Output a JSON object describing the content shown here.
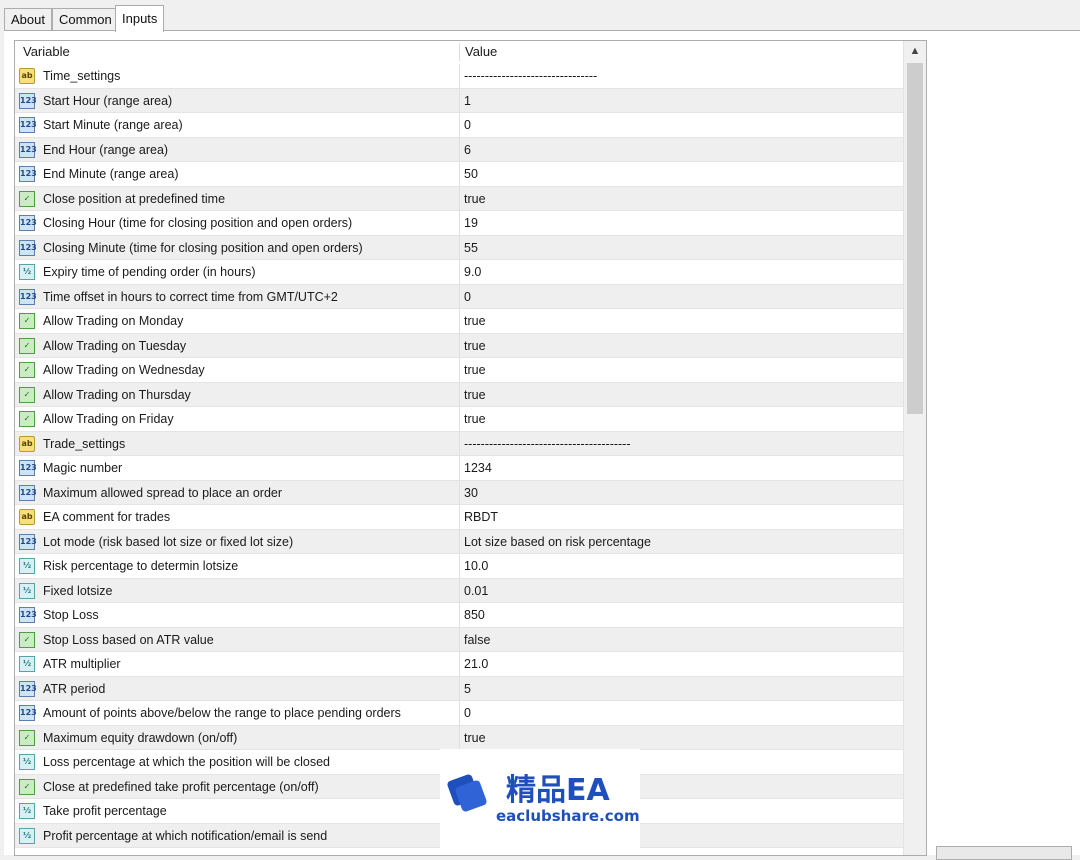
{
  "tabs": [
    {
      "label": "About"
    },
    {
      "label": "Common"
    },
    {
      "label": "Inputs"
    }
  ],
  "grid": {
    "columns": {
      "variable": "Variable",
      "value": "Value"
    },
    "rows": [
      {
        "icon": "ab",
        "name": "Time_settings",
        "value": "--------------------------------"
      },
      {
        "icon": "123",
        "name": "Start Hour (range area)",
        "value": "1"
      },
      {
        "icon": "123",
        "name": "Start Minute (range area)",
        "value": "0"
      },
      {
        "icon": "123",
        "name": "End Hour (range area)",
        "value": "6"
      },
      {
        "icon": "123",
        "name": "End Minute (range area)",
        "value": "50"
      },
      {
        "icon": "bool",
        "name": "Close position at predefined time",
        "value": "true"
      },
      {
        "icon": "123",
        "name": "Closing Hour (time for closing position and open orders)",
        "value": "19"
      },
      {
        "icon": "123",
        "name": "Closing Minute (time for closing position and open orders)",
        "value": "55"
      },
      {
        "icon": "dbl",
        "name": "Expiry time of pending order (in hours)",
        "value": "9.0"
      },
      {
        "icon": "123",
        "name": "Time offset in hours to correct time from GMT/UTC+2",
        "value": "0"
      },
      {
        "icon": "bool",
        "name": "Allow Trading on Monday",
        "value": "true"
      },
      {
        "icon": "bool",
        "name": "Allow Trading on Tuesday",
        "value": "true"
      },
      {
        "icon": "bool",
        "name": "Allow Trading on Wednesday",
        "value": "true"
      },
      {
        "icon": "bool",
        "name": "Allow Trading on Thursday",
        "value": "true"
      },
      {
        "icon": "bool",
        "name": "Allow Trading on Friday",
        "value": "true"
      },
      {
        "icon": "ab",
        "name": "Trade_settings",
        "value": "----------------------------------------"
      },
      {
        "icon": "123",
        "name": "Magic number",
        "value": "1234"
      },
      {
        "icon": "123",
        "name": "Maximum allowed spread to place an order",
        "value": "30"
      },
      {
        "icon": "ab",
        "name": "EA comment for trades",
        "value": "RBDT"
      },
      {
        "icon": "123",
        "name": "Lot mode (risk based lot size or fixed lot size)",
        "value": "Lot size based on risk percentage"
      },
      {
        "icon": "dbl",
        "name": "Risk percentage to determin lotsize",
        "value": "10.0"
      },
      {
        "icon": "dbl",
        "name": "Fixed lotsize",
        "value": "0.01"
      },
      {
        "icon": "123",
        "name": "Stop Loss",
        "value": "850"
      },
      {
        "icon": "bool",
        "name": "Stop Loss based on ATR value",
        "value": "false"
      },
      {
        "icon": "dbl",
        "name": "ATR multiplier",
        "value": "21.0"
      },
      {
        "icon": "123",
        "name": "ATR period",
        "value": "5"
      },
      {
        "icon": "123",
        "name": "Amount of points above/below the range to place pending orders",
        "value": "0"
      },
      {
        "icon": "bool",
        "name": "Maximum equity drawdown (on/off)",
        "value": "true"
      },
      {
        "icon": "dbl",
        "name": "Loss percentage at which the position will be closed",
        "value": ""
      },
      {
        "icon": "bool",
        "name": "Close at predefined take profit percentage (on/off)",
        "value": ""
      },
      {
        "icon": "dbl",
        "name": "Take profit percentage",
        "value": ""
      },
      {
        "icon": "dbl",
        "name": "Profit percentage at which notification/email is send",
        "value": ""
      }
    ]
  },
  "icon_glyphs": {
    "ab": "ab",
    "123": "123",
    "bool": "✓",
    "dbl": "½"
  },
  "watermark": {
    "title": "精品EA",
    "url": "eaclubshare.com",
    "color": "#1e4fbd"
  }
}
